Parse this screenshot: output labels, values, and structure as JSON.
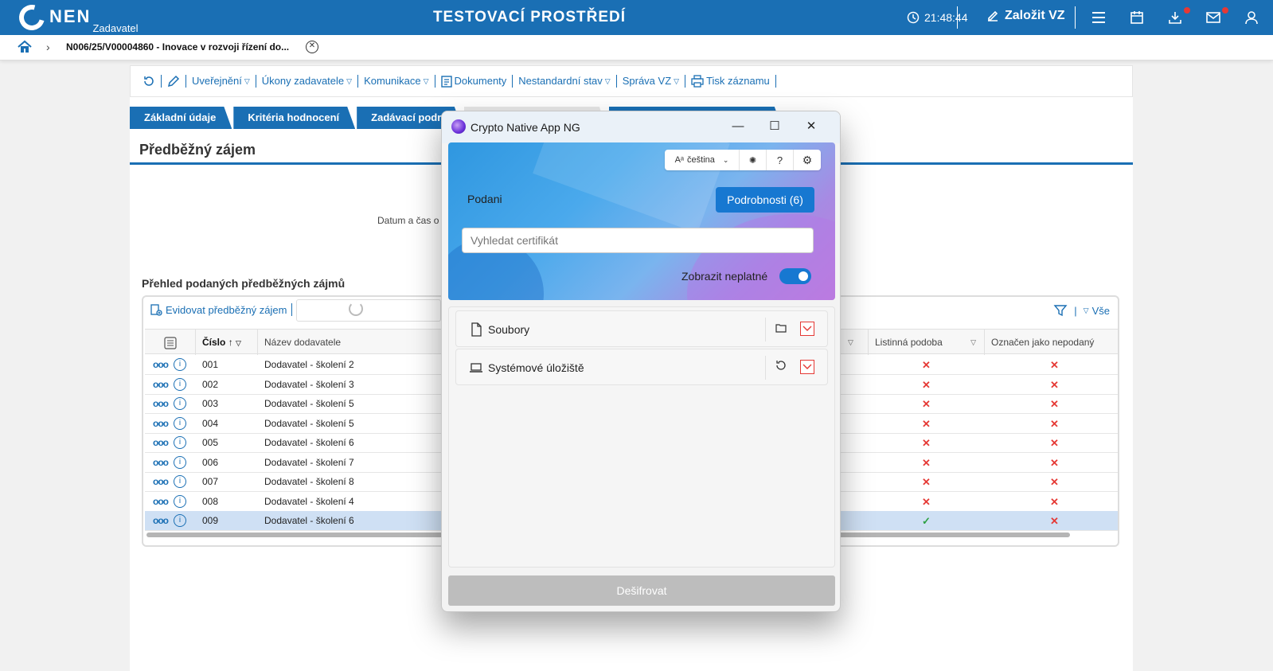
{
  "header": {
    "logo_text": "NEN",
    "logo_sub": "Zadavatel",
    "env_title": "TESTOVACÍ PROSTŘEDÍ",
    "clock": "21:48:44",
    "create_vz": "Založit VZ"
  },
  "breadcrumb": {
    "text": "N006/25/V00004860 - Inovace v rozvoji řízení do..."
  },
  "toolbar": {
    "items": [
      "Uveřejnění",
      "Úkony zadavatele",
      "Komunikace",
      "Dokumenty",
      "Nestandardní stav",
      "Správa VZ",
      "Tisk záznamu"
    ]
  },
  "tabs": [
    "Základní údaje",
    "Kritéria hodnocení",
    "Zadávací podm"
  ],
  "section": {
    "title": "Předběžný zájem",
    "datum_label": "Datum a čas o",
    "overview_title": "Přehled podaných předběžných zájmů"
  },
  "grid": {
    "evid_btn": "Evidovat předběžný zájem",
    "vse": "Vše",
    "col_cislo": "Číslo",
    "col_nazev": "Název dodavatele",
    "col_listinna": "Listinná podoba",
    "col_oznacen": "Označen jako nepodaný",
    "rows": [
      {
        "cislo": "001",
        "nazev": "Dodavatel - školení 2",
        "listinna": "✕",
        "oznacen": "✕"
      },
      {
        "cislo": "002",
        "nazev": "Dodavatel - školení 3",
        "listinna": "✕",
        "oznacen": "✕"
      },
      {
        "cislo": "003",
        "nazev": "Dodavatel - školení 5",
        "listinna": "✕",
        "oznacen": "✕"
      },
      {
        "cislo": "004",
        "nazev": "Dodavatel - školení 5",
        "listinna": "✕",
        "oznacen": "✕"
      },
      {
        "cislo": "005",
        "nazev": "Dodavatel - školení 6",
        "listinna": "✕",
        "oznacen": "✕"
      },
      {
        "cislo": "006",
        "nazev": "Dodavatel - školení 7",
        "listinna": "✕",
        "oznacen": "✕"
      },
      {
        "cislo": "007",
        "nazev": "Dodavatel - školení 8",
        "listinna": "✕",
        "oznacen": "✕"
      },
      {
        "cislo": "008",
        "nazev": "Dodavatel - školení 4",
        "listinna": "✕",
        "oznacen": "✕"
      },
      {
        "cislo": "009",
        "nazev": "Dodavatel - školení 6",
        "listinna": "✓",
        "oznacen": "✕"
      }
    ]
  },
  "modal": {
    "title": "Crypto Native App NG",
    "language": "čeština",
    "podani": "Podani",
    "details_btn": "Podrobnosti (6)",
    "search_placeholder": "Vyhledat certifikát",
    "show_invalid": "Zobrazit neplatné",
    "item_files": "Soubory",
    "item_system": "Systémové úložiště",
    "decrypt_btn": "Dešifrovat"
  },
  "colors": {
    "brand": "#1a6fb4",
    "accent": "#1778d1",
    "error": "#e53935",
    "success": "#2ea043"
  }
}
